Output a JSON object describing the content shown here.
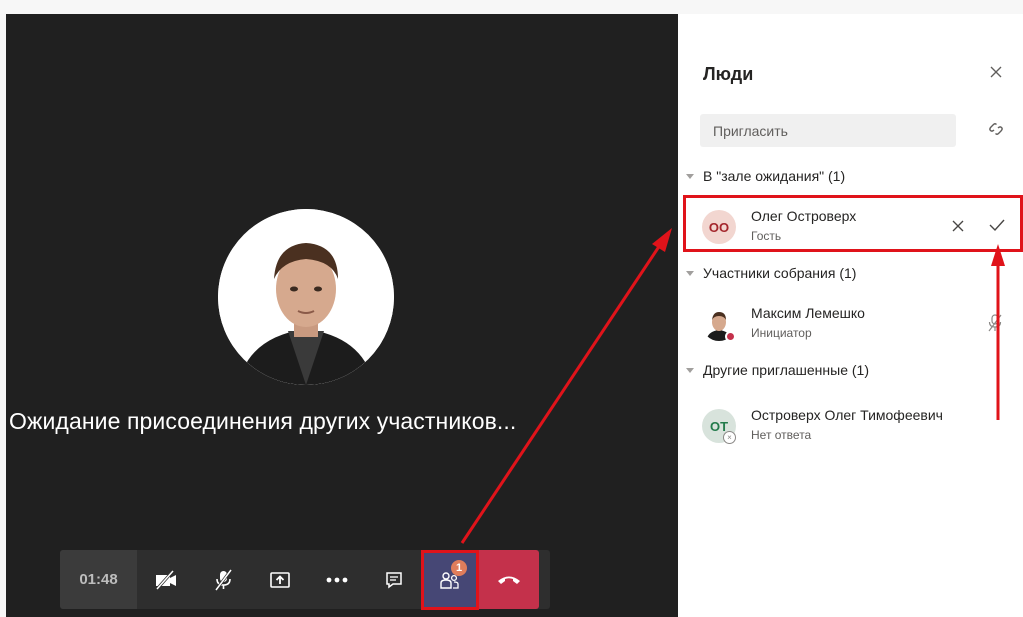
{
  "stage": {
    "waiting_message": "Ожидание присоединения других участников..."
  },
  "callbar": {
    "timer": "01:48",
    "people_badge": "1",
    "buttons": [
      "camera-off-icon",
      "mic-off-icon",
      "share-screen-icon",
      "more-icon",
      "chat-icon",
      "participants-icon",
      "hang-up-icon"
    ]
  },
  "panel": {
    "title": "Люди",
    "invite_placeholder": "Пригласить",
    "sections": [
      {
        "label": "В \"зале ожидания\" (1)",
        "people": [
          {
            "initials": "ОО",
            "name": "Олег Островерх",
            "role": "Гость"
          }
        ]
      },
      {
        "label": "Участники собрания (1)",
        "people": [
          {
            "initials": "",
            "name": "Максим Лемешко",
            "role": "Инициатор"
          }
        ]
      },
      {
        "label": "Другие приглашенные (1)",
        "people": [
          {
            "initials": "ОТ",
            "name": "Островерх Олег Тимофеевич",
            "role": "Нет ответа"
          }
        ]
      }
    ]
  },
  "colors": {
    "stage_bg": "#202020",
    "callbar_bg": "#2e2e2e",
    "active_button": "#464775",
    "hangup": "#c4314b",
    "annotation_red": "#e0131a",
    "badge": "#e07d5b"
  }
}
